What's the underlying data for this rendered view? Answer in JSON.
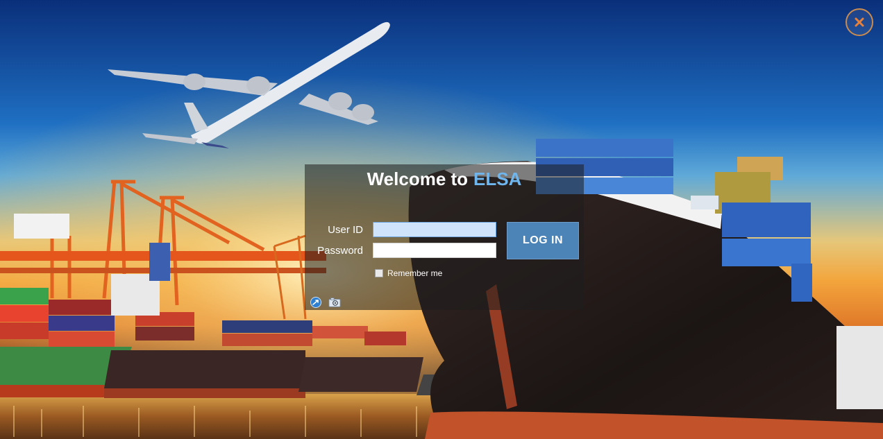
{
  "window": {
    "close_icon": "close-icon",
    "close_color": "#e8813a"
  },
  "login": {
    "welcome_prefix": "Welcome to",
    "brand": "ELSA",
    "brand_color": "#6fb6ee",
    "user_id_label": "User ID",
    "user_id_value": "",
    "password_label": "Password",
    "password_value": "",
    "login_button": "LOG IN",
    "login_button_color": "#4d84b8",
    "remember_label": "Remember me",
    "remember_checked": false
  },
  "tools": [
    {
      "icon": "remote-help-icon"
    },
    {
      "icon": "camera-icon"
    }
  ]
}
